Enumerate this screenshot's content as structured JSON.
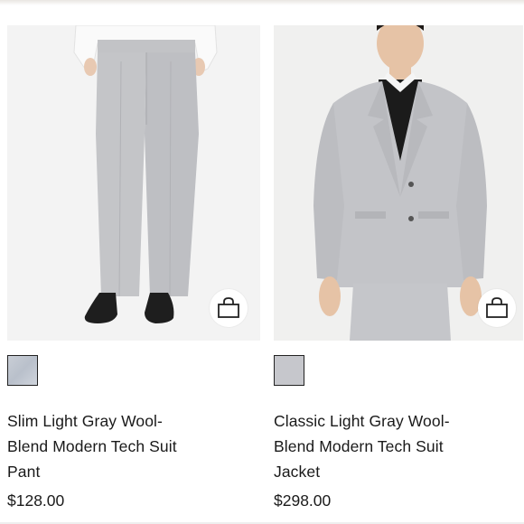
{
  "products": [
    {
      "title": "Slim Light Gray Wool-Blend Modern Tech Suit Pant",
      "price": "$128.00",
      "image_icon": "suit-pant-photo",
      "swatch_color": "#c4cad3",
      "bag_icon": "shopping-bag-icon"
    },
    {
      "title": "Classic Light Gray Wool-Blend Modern Tech Suit Jacket",
      "price": "$298.00",
      "image_icon": "suit-jacket-photo",
      "swatch_color": "#c6c7cc",
      "bag_icon": "shopping-bag-icon"
    }
  ]
}
